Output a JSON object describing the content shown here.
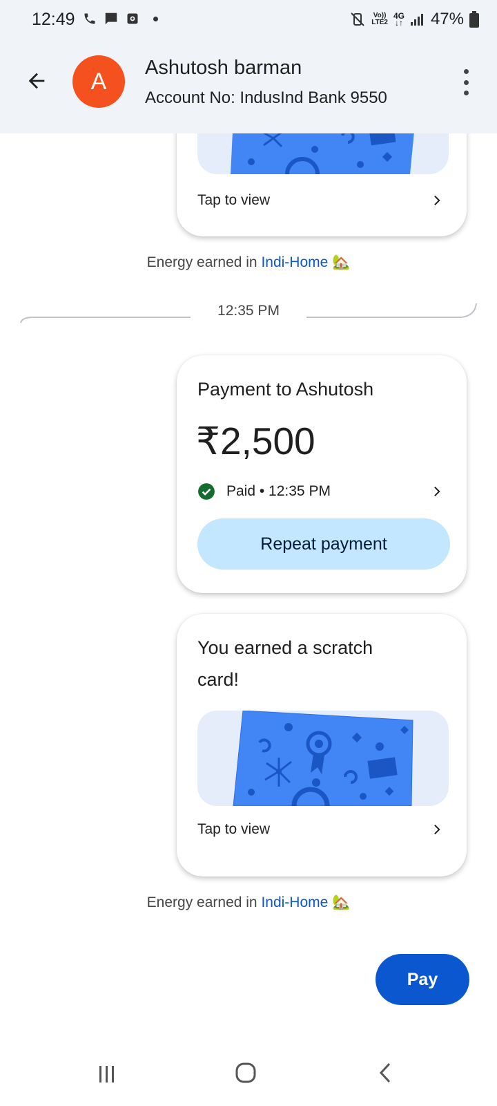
{
  "status_bar": {
    "time": "12:49",
    "network_tag_top": "Vo))",
    "network_tag_bottom": "LTE2",
    "network_4g": "4G",
    "battery": "47%"
  },
  "header": {
    "avatar_letter": "A",
    "contact_name": "Ashutosh barman",
    "account_text": "Account No: IndusInd Bank 9550"
  },
  "messages": {
    "top_card": {
      "tap_label": "Tap to view"
    },
    "energy_1": {
      "prefix": "Energy earned in ",
      "link": "Indi-Home",
      "emoji": "🏡"
    },
    "timestamp": "12:35 PM",
    "payment_card": {
      "title": "Payment to Ashutosh",
      "amount": "₹2,500",
      "status": "Paid • 12:35 PM",
      "repeat_label": "Repeat payment"
    },
    "scratch_card": {
      "title_line1": "You earned a scratch",
      "title_line2": "card!",
      "tap_label": "Tap to view"
    },
    "energy_2": {
      "prefix": "Energy earned in ",
      "link": "Indi-Home",
      "emoji": "🏡"
    }
  },
  "pay_button": {
    "label": "Pay"
  },
  "colors": {
    "header_bg": "#f0f4f9",
    "avatar": "#f4511e",
    "link": "#0b57d0",
    "repeat_btn": "#c2e7ff",
    "pay_btn": "#0b57d0",
    "scratch_blue": "#4285f4",
    "paid_green": "#146c2e"
  }
}
